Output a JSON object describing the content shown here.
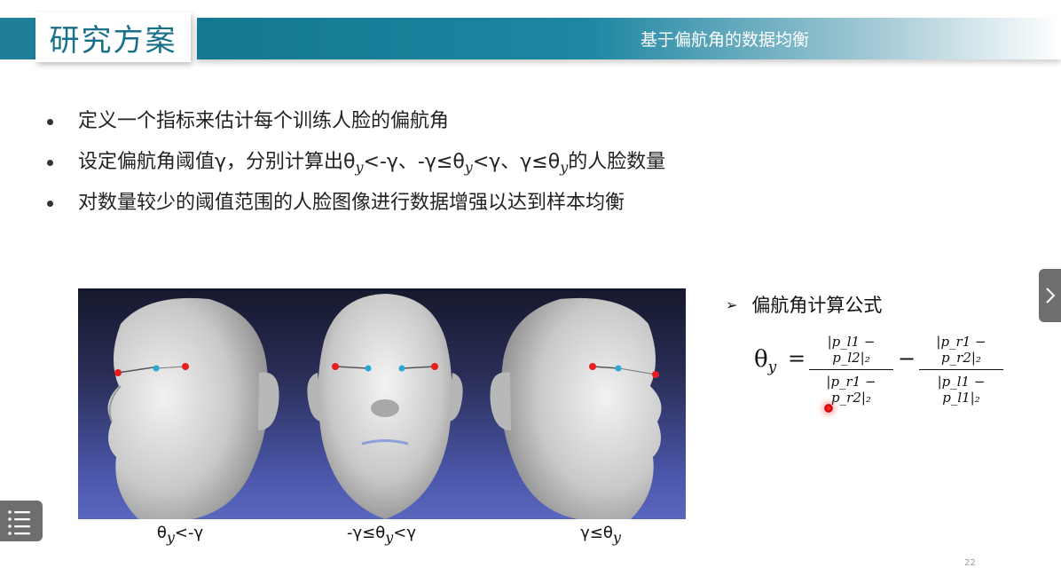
{
  "header": {
    "title": "研究方案",
    "subtitle": "基于偏航角的数据均衡"
  },
  "bullets": [
    {
      "text": "定义一个指标来估计每个训练人脸的偏航角"
    },
    {
      "prefix": "设定偏航角阈值γ，分别计算出θ",
      "sub1": "y",
      "mid1": "<-γ、-γ≤θ",
      "sub2": "y",
      "mid2": "<γ、γ≤θ",
      "sub3": "y",
      "suffix": "的人脸数量"
    },
    {
      "text": "对数量较少的阈值范围的人脸图像进行数据增强以达到样本均衡"
    }
  ],
  "figure": {
    "captions": [
      {
        "pre": "θ",
        "sub": "y",
        "post": "<-γ"
      },
      {
        "pre": "-γ≤θ",
        "sub": "y",
        "post": "<γ"
      },
      {
        "pre": "γ≤θ",
        "sub": "y",
        "post": ""
      }
    ]
  },
  "formula": {
    "heading": "偏航角计算公式",
    "lhs": "θ",
    "lhs_sub": "y",
    "eq": "=",
    "minus": "−",
    "frac1_num": "|p_l1 − p_l2|₂",
    "frac1_den": "|p_r1 − p_r2|₂",
    "frac2_num": "|p_r1 − p_r2|₂",
    "frac2_den": "|p_l1 − p_l1|₂"
  },
  "nav": {
    "next_icon": "chevron-right-icon",
    "menu_icon": "menu-list-icon",
    "page_number": "22"
  },
  "colors": {
    "accent": "#1f7f99",
    "title": "#17708a",
    "landmark_red": "#e81d1d",
    "landmark_blue": "#29a9d6"
  }
}
